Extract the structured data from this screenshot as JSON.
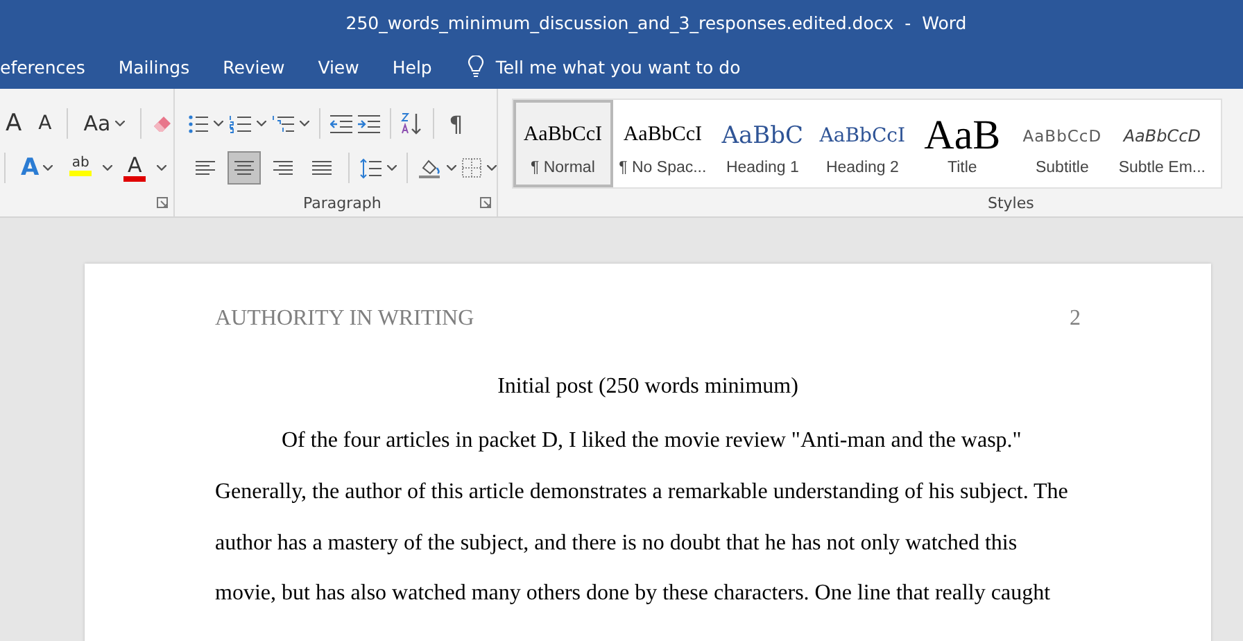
{
  "window": {
    "title": "250_words_minimum_discussion_and_3_responses.edited.docx  -  Word"
  },
  "tabs": [
    {
      "label": "eferences",
      "selected": false
    },
    {
      "label": "Mailings",
      "selected": false
    },
    {
      "label": "Review",
      "selected": false
    },
    {
      "label": "View",
      "selected": false
    },
    {
      "label": "Help",
      "selected": false
    }
  ],
  "tell_me": {
    "placeholder": "Tell me what you want to do"
  },
  "font_group": {
    "grow_font": "A",
    "shrink_font": "A",
    "change_case": "Aa",
    "text_effects": "A",
    "highlight": "ab",
    "font_color": "A"
  },
  "paragraph_group": {
    "label": "Paragraph",
    "show_marks": "¶",
    "alignments": [
      {
        "kind": "left",
        "selected": false
      },
      {
        "kind": "center",
        "selected": true
      },
      {
        "kind": "right",
        "selected": false
      },
      {
        "kind": "justify",
        "selected": false
      }
    ]
  },
  "styles_group": {
    "label": "Styles",
    "styles": [
      {
        "preview": "AaBbCcI",
        "name": "¶ Normal",
        "kind": "normal",
        "selected": true
      },
      {
        "preview": "AaBbCcI",
        "name": "¶ No Spac...",
        "kind": "normal",
        "selected": false
      },
      {
        "preview": "AaBbC",
        "name": "Heading 1",
        "kind": "heading1",
        "selected": false
      },
      {
        "preview": "AaBbCcI",
        "name": "Heading 2",
        "kind": "heading2",
        "selected": false
      },
      {
        "preview": "AaB",
        "name": "Title",
        "kind": "title",
        "selected": false
      },
      {
        "preview": "AaBbCcD",
        "name": "Subtitle",
        "kind": "subtitle",
        "selected": false
      },
      {
        "preview": "AaBbCcD",
        "name": "Subtle Em...",
        "kind": "emphasis",
        "selected": false
      }
    ]
  },
  "document": {
    "header": "AUTHORITY IN WRITING",
    "page_number": "2",
    "heading": "Initial post (250 words minimum)",
    "paragraph": "Of the four articles in packet D, I liked the movie review \"Anti-man and the wasp.\" Generally, the author of this article demonstrates a remarkable understanding of his subject. The author has a mastery of the subject, and there is no doubt that he has not only watched this movie, but has also watched many others done by these characters. One line that really caught"
  }
}
